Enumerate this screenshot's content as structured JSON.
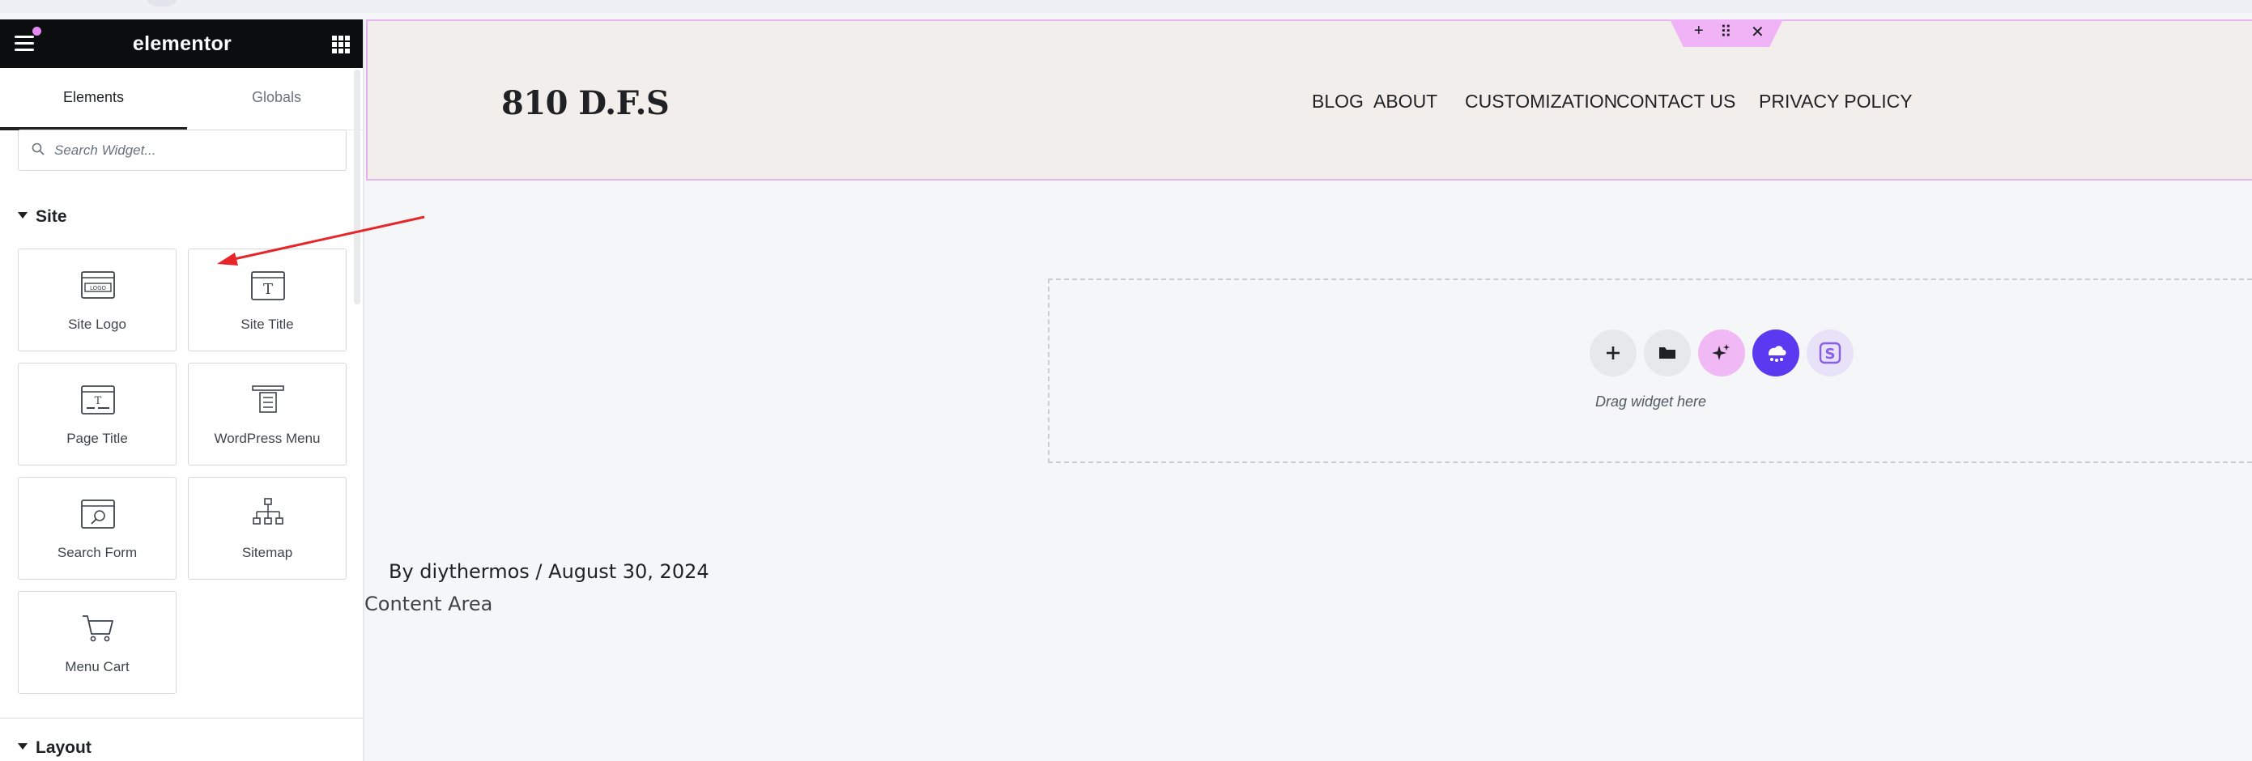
{
  "app": {
    "brand": "elementor",
    "tabs": [
      "Elements",
      "Globals"
    ]
  },
  "search": {
    "placeholder": "Search Widget..."
  },
  "sections": {
    "site": "Site",
    "layout": "Layout"
  },
  "widgets": [
    {
      "label": "Site Logo",
      "icon": "site-logo-icon"
    },
    {
      "label": "Site Title",
      "icon": "site-title-icon"
    },
    {
      "label": "Page Title",
      "icon": "page-title-icon"
    },
    {
      "label": "WordPress Menu",
      "icon": "wordpress-menu-icon"
    },
    {
      "label": "Search Form",
      "icon": "search-form-icon"
    },
    {
      "label": "Sitemap",
      "icon": "sitemap-icon"
    },
    {
      "label": "Menu Cart",
      "icon": "cart-icon"
    }
  ],
  "header": {
    "site_title": "810 D.F.S",
    "nav": [
      "BLOG",
      "ABOUT",
      "CUSTOMIZATION",
      "CONTACT US",
      "PRIVACY POLICY"
    ],
    "handle_controls": [
      "+",
      "⠿",
      "✕"
    ]
  },
  "canvas": {
    "drop_hint": "Drag widget here",
    "post_meta": "By diythermos / August 30, 2024",
    "content_area": "Content Area",
    "actions": [
      "add-icon",
      "folder-icon",
      "ai-sparkle-icon",
      "cloud-library-icon",
      "s-logo-icon"
    ]
  },
  "colors": {
    "panel_header": "#0c0d0e",
    "accent_pink": "#e489f3",
    "section_border": "#e6b3ee",
    "header_bg": "#f2eeeb",
    "purple": "#5b39f0",
    "annotation_red": "#e8262a"
  }
}
